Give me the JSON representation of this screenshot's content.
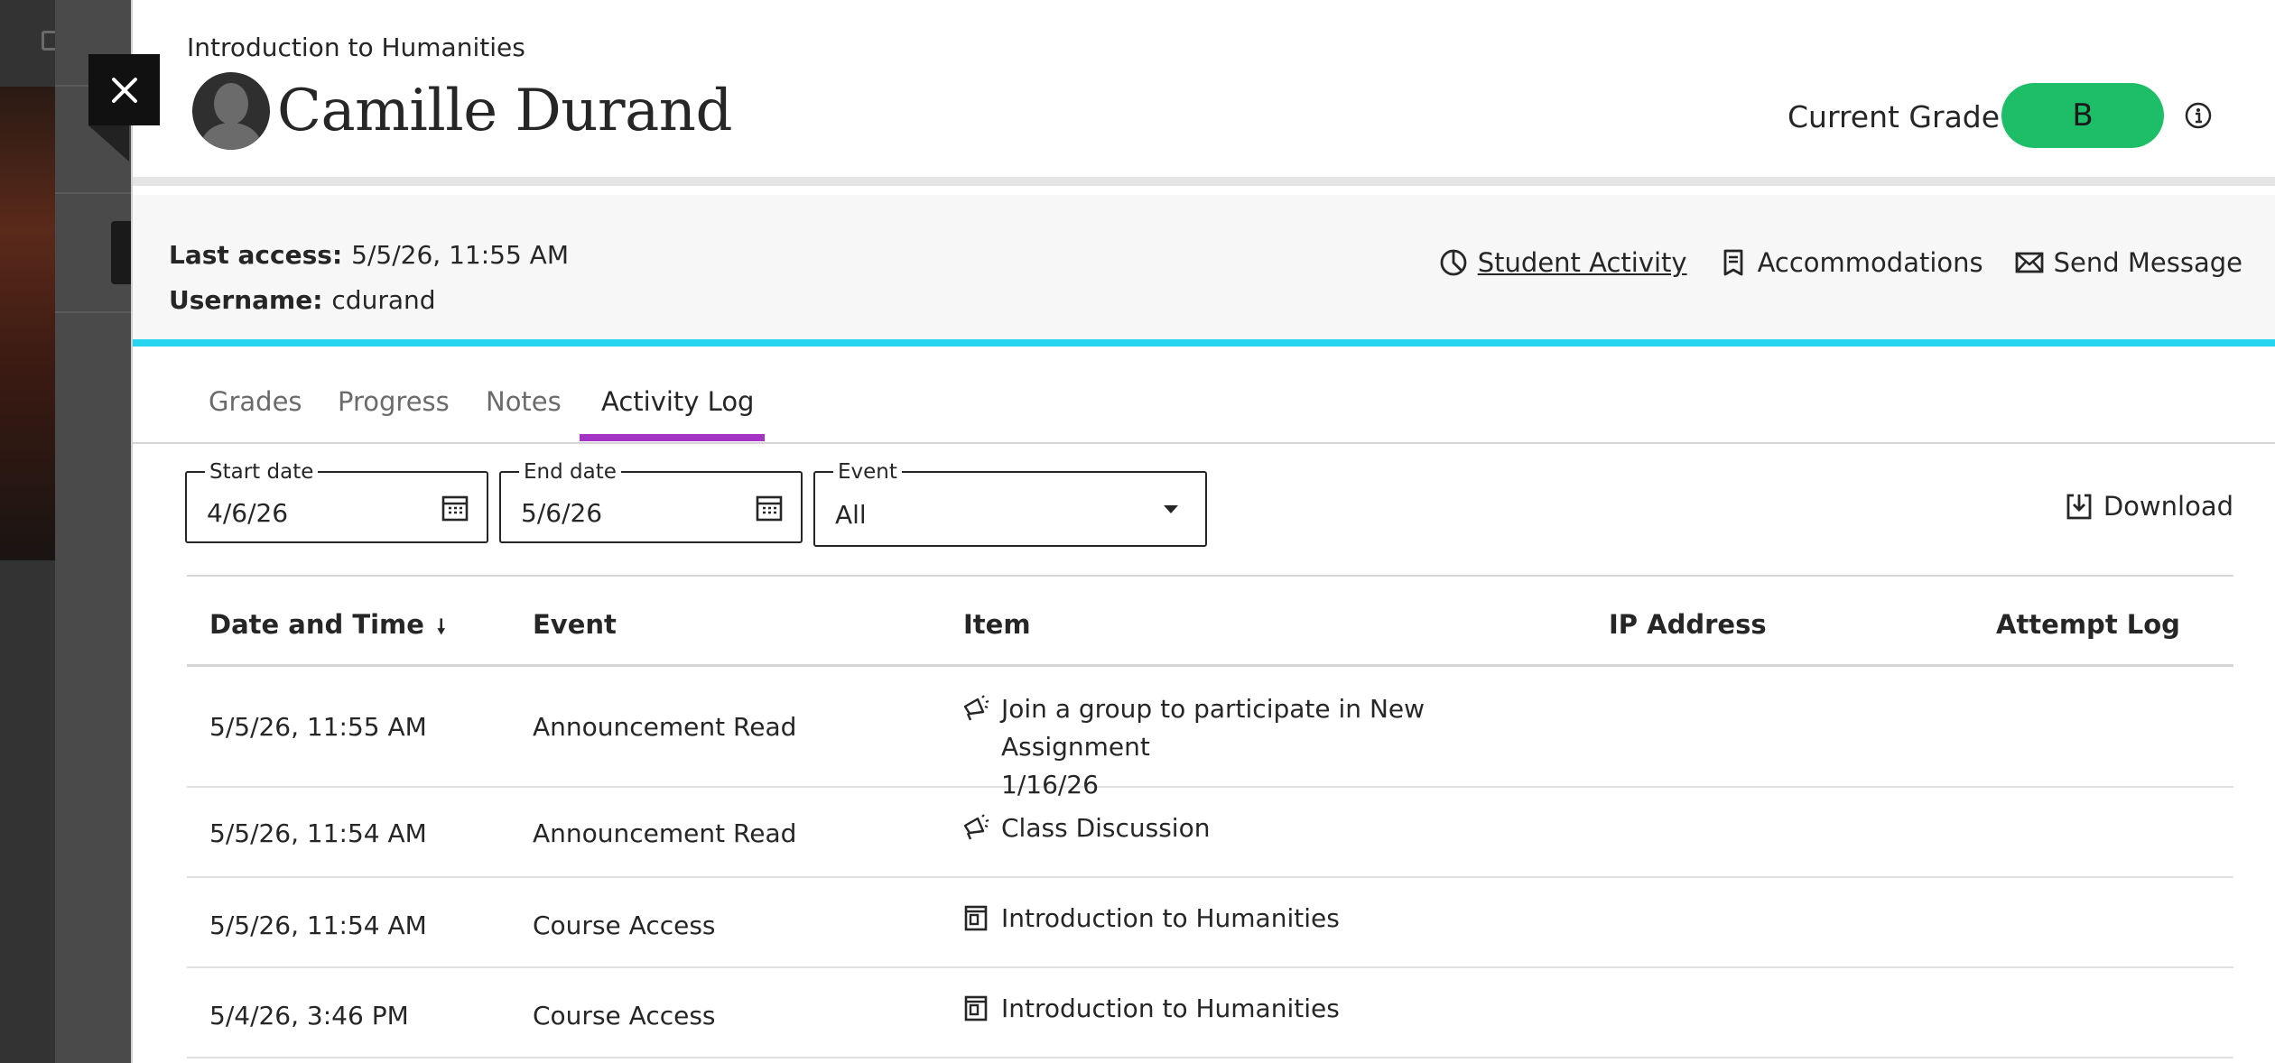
{
  "course": "Introduction to Humanities",
  "student": {
    "name": "Camille Durand",
    "last_access_label": "Last access:",
    "last_access": "5/5/26, 11:55 AM",
    "username_label": "Username:",
    "username": "cdurand"
  },
  "grade": {
    "label": "Current Grade",
    "value": "B",
    "color": "#1dbe67"
  },
  "actions": {
    "student_activity": "Student Activity",
    "accommodations": "Accommodations",
    "send_message": "Send Message"
  },
  "tabs": [
    {
      "label": "Grades"
    },
    {
      "label": "Progress"
    },
    {
      "label": "Notes"
    },
    {
      "label": "Activity Log",
      "active": true
    }
  ],
  "filters": {
    "start_label": "Start date",
    "start_value": "4/6/26",
    "end_label": "End date",
    "end_value": "5/6/26",
    "event_label": "Event",
    "event_value": "All",
    "download": "Download"
  },
  "table": {
    "headers": [
      "Date and Time",
      "Event",
      "Item",
      "IP Address",
      "Attempt Log"
    ],
    "sort_icon": "arrow-down-icon",
    "rows": [
      {
        "date": "5/5/26, 11:55 AM",
        "event": "Announcement Read",
        "icon": "megaphone-icon",
        "item_line1": "Join a group to participate in New Assignment",
        "item_line2": "1/16/26"
      },
      {
        "date": "5/5/26, 11:54 AM",
        "event": "Announcement Read",
        "icon": "megaphone-icon",
        "item_line1": "Class Discussion",
        "item_line2": ""
      },
      {
        "date": "5/5/26, 11:54 AM",
        "event": "Course Access",
        "icon": "course-icon",
        "item_line1": "Introduction to Humanities",
        "item_line2": ""
      },
      {
        "date": "5/4/26, 3:46 PM",
        "event": "Course Access",
        "icon": "course-icon",
        "item_line1": "Introduction to Humanities",
        "item_line2": ""
      }
    ]
  },
  "colors": {
    "accent_band": "#28d5f0",
    "tab_underline": "#a434c4"
  }
}
